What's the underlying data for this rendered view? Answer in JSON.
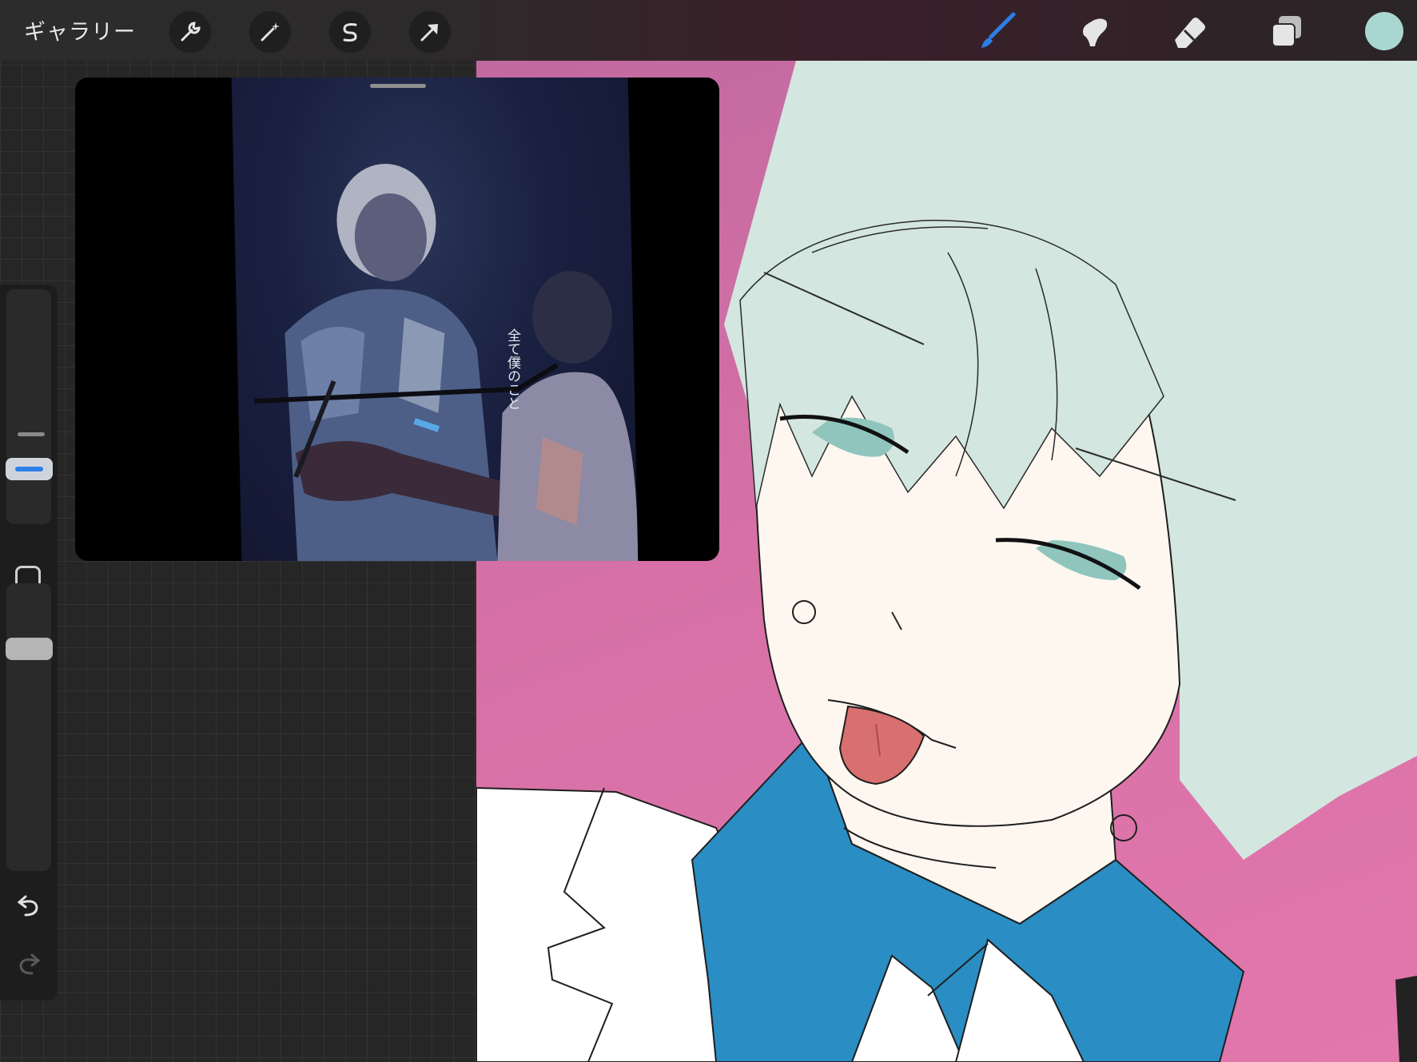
{
  "topbar": {
    "gallery_label": "ギャラリー",
    "tools_left": [
      {
        "name": "actions-wrench-icon"
      },
      {
        "name": "adjustments-wand-icon"
      },
      {
        "name": "selection-s-icon"
      },
      {
        "name": "transform-arrow-icon"
      }
    ],
    "tools_right": [
      {
        "name": "brush-icon",
        "active": true,
        "color": "#2b7fe6"
      },
      {
        "name": "smudge-icon",
        "active": false
      },
      {
        "name": "eraser-icon",
        "active": false
      },
      {
        "name": "layers-icon",
        "active": false
      }
    ],
    "current_color": "#a9d6d0"
  },
  "sidebar": {
    "brush_size_thumb_color": "#2b7fe6",
    "opacity_thumb_color": "#b5b5b5"
  },
  "reference": {
    "caption": "全て僕のこと"
  },
  "colors": {
    "accent": "#2b7fe6",
    "canvas_bg": "#e277ac",
    "hair": "#d3e6df",
    "skin": "#fdf7f0",
    "collar": "#2a8dc3",
    "tongue": "#d8706f",
    "eyes": "#8fc5bd"
  }
}
